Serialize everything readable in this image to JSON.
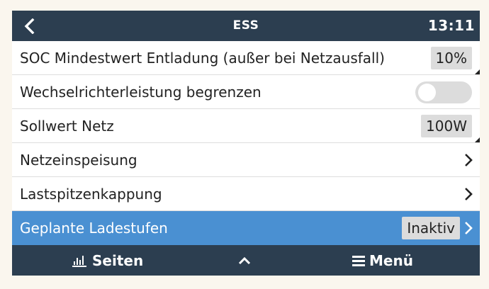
{
  "header": {
    "title": "ESS",
    "time": "13:11"
  },
  "rows": [
    {
      "label": "SOC Mindestwert Entladung (außer bei Netzausfall)",
      "value": "10%"
    },
    {
      "label": "Wechselrichterleistung begrenzen",
      "toggle_on": false
    },
    {
      "label": "Sollwert Netz",
      "value": "100W"
    },
    {
      "label": "Netzeinspeisung"
    },
    {
      "label": "Lastspitzenkappung"
    },
    {
      "label": "Geplante Ladestufen",
      "value": "Inaktiv",
      "selected": true
    }
  ],
  "footer": {
    "pages_label": "Seiten",
    "menu_label": "Menü"
  },
  "colors": {
    "bar": "#2c3e50",
    "selected": "#4a90d2",
    "value_box": "#dcdcdc"
  }
}
